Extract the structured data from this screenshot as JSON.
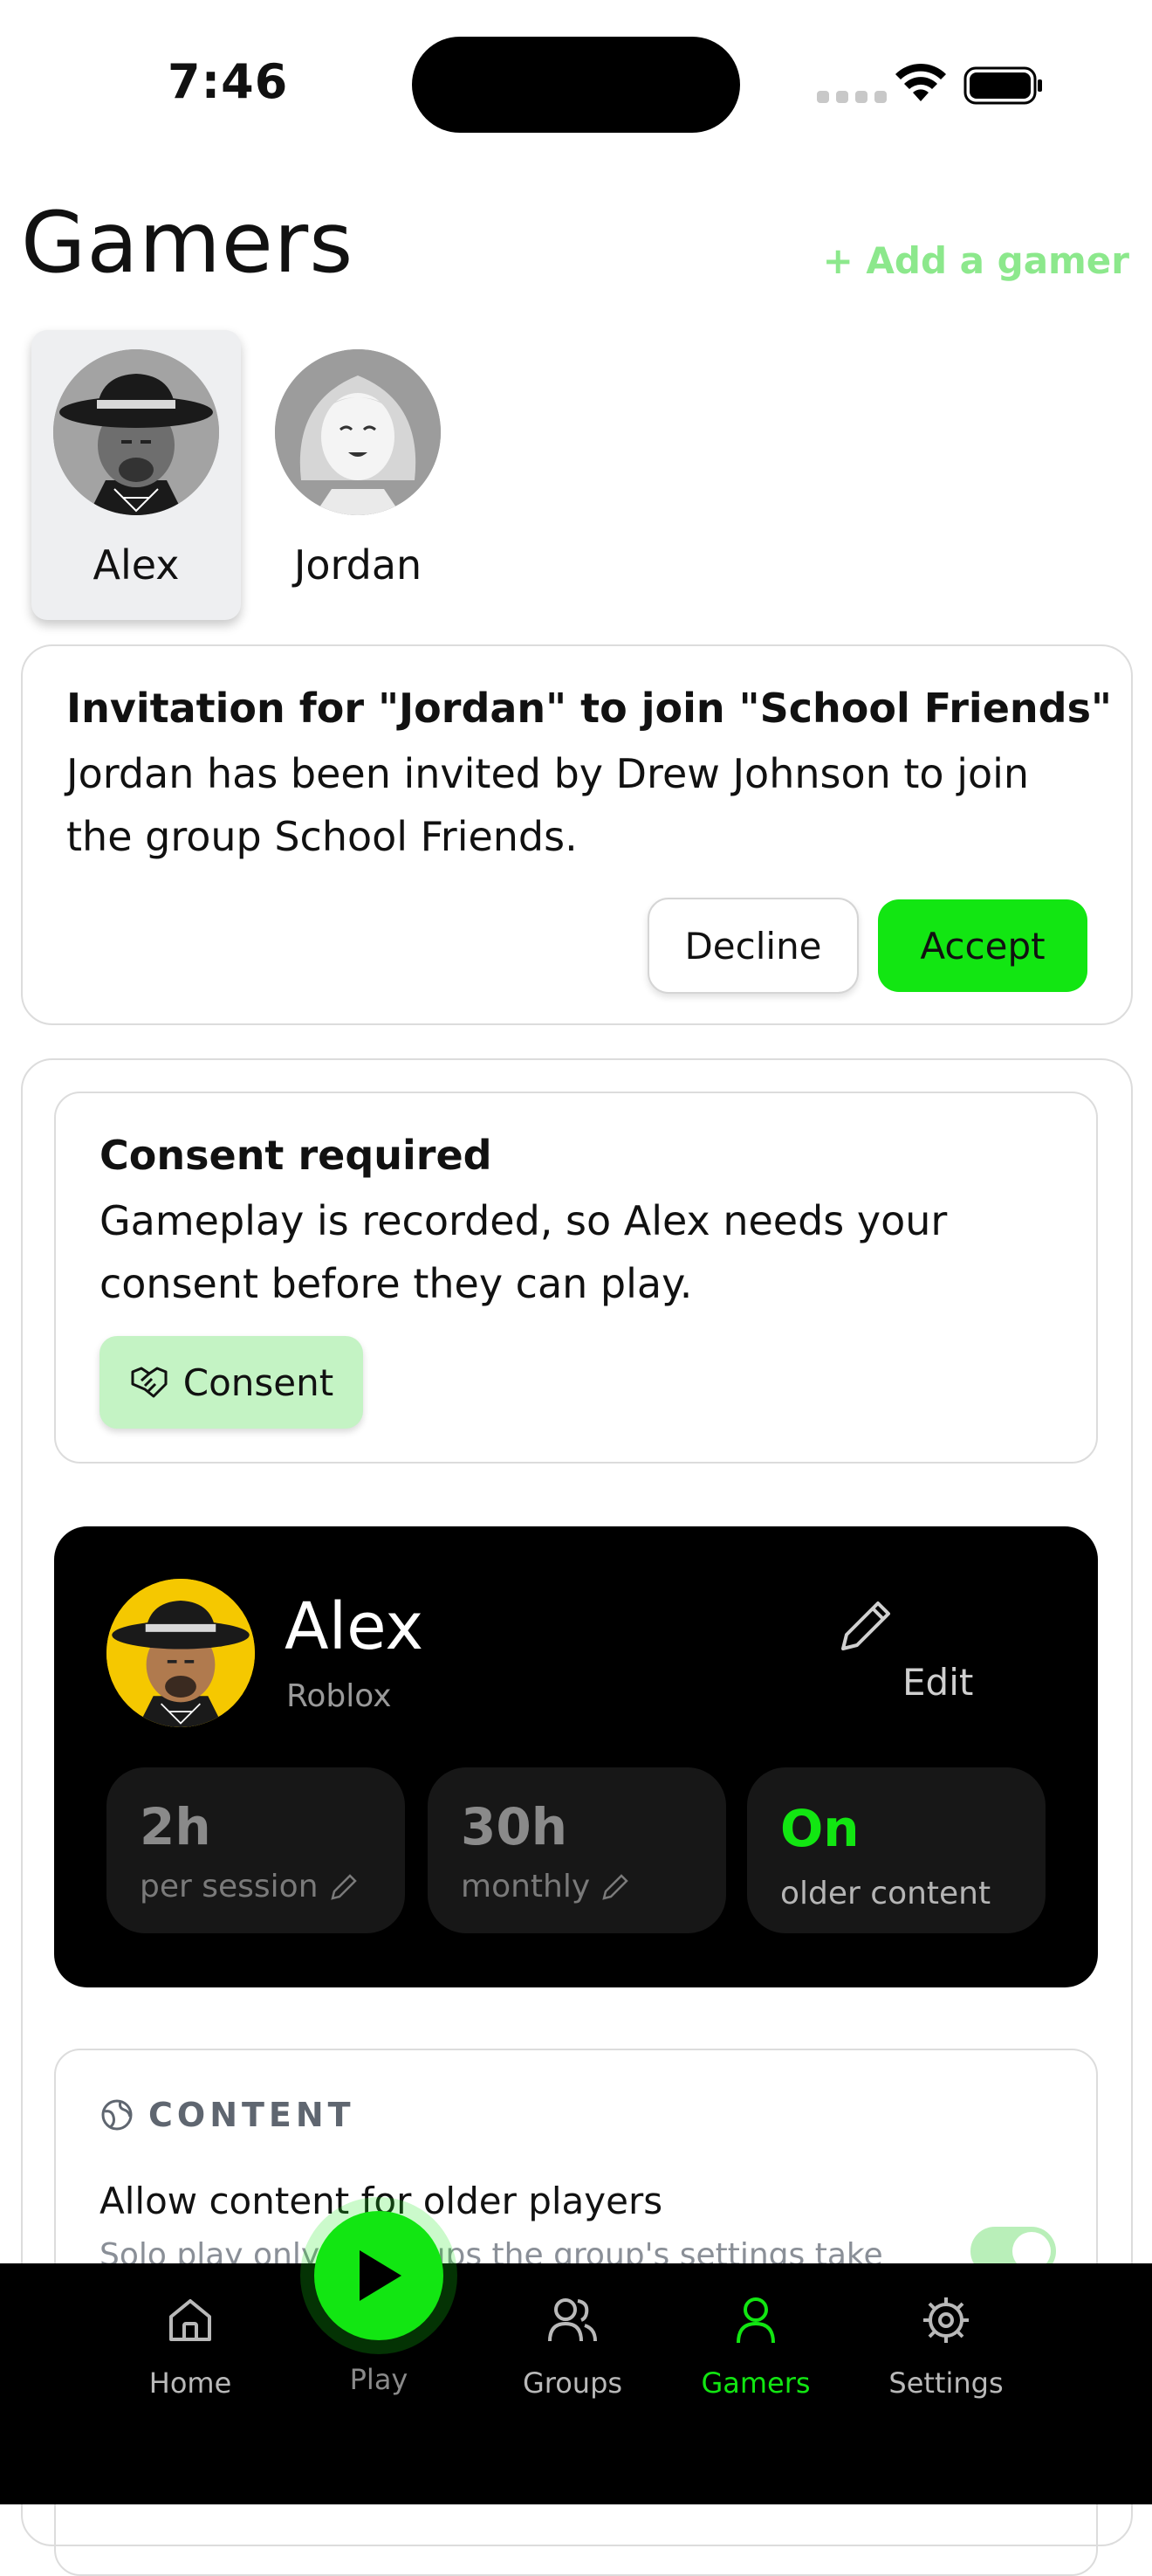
{
  "status_bar": {
    "time": "7:46"
  },
  "header": {
    "title": "Gamers",
    "add_gamer": "+ Add a gamer"
  },
  "gamers": [
    {
      "name": "Alex",
      "selected": true
    },
    {
      "name": "Jordan",
      "selected": false
    }
  ],
  "invitation": {
    "title": "Invitation for \"Jordan\" to join \"School Friends\"",
    "body": "Jordan has been invited by Drew Johnson to join the group School Friends.",
    "decline": "Decline",
    "accept": "Accept"
  },
  "consent": {
    "title": "Consent required",
    "body": "Gameplay is recorded, so Alex needs your consent before they can play.",
    "button": "Consent"
  },
  "profile": {
    "name": "Alex",
    "game": "Roblox",
    "edit": "Edit",
    "stats": [
      {
        "value": "2h",
        "label": "per session"
      },
      {
        "value": "30h",
        "label": "monthly"
      },
      {
        "value": "On",
        "label": "older content"
      }
    ]
  },
  "content": {
    "section_title": "CONTENT",
    "option_label": "Allow content for older players",
    "option_sub": "Solo play only. In groups the group's settings take",
    "toggle_on": true
  },
  "tabs": [
    {
      "label": "Home",
      "icon": "home-icon"
    },
    {
      "label": "Play",
      "icon": "play-icon"
    },
    {
      "label": "Groups",
      "icon": "groups-icon"
    },
    {
      "label": "Gamers",
      "icon": "gamer-icon",
      "active": true
    },
    {
      "label": "Settings",
      "icon": "gear-icon"
    }
  ],
  "colors": {
    "accent": "#12e612",
    "accent_light": "#8ce88c",
    "consent_bg": "#c4f3c4"
  }
}
